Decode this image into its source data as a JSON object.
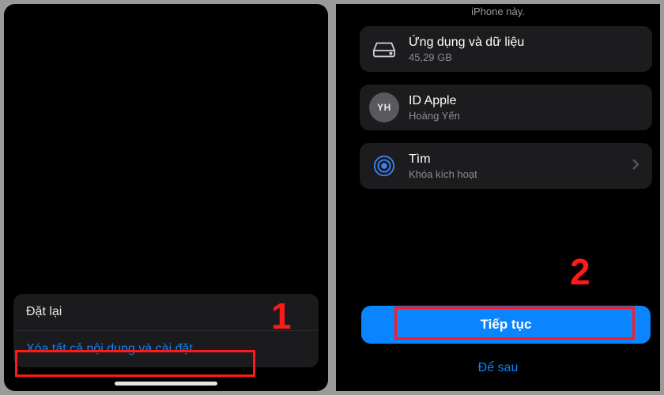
{
  "left": {
    "reset_label": "Đặt lại",
    "erase_label": "Xóa tất cả nội dung và cài đặt"
  },
  "right": {
    "header_hint": "iPhone này.",
    "cards": {
      "apps": {
        "title": "Ứng dụng và dữ liệu",
        "sub": "45,29 GB"
      },
      "apple_id": {
        "title": "ID Apple",
        "sub": "Hoàng Yến",
        "initials": "YH"
      },
      "find": {
        "title": "Tìm",
        "sub": "Khóa kích hoạt"
      }
    },
    "continue_label": "Tiếp tục",
    "later_label": "Để sau"
  },
  "annotations": {
    "step1": "1",
    "step2": "2"
  }
}
